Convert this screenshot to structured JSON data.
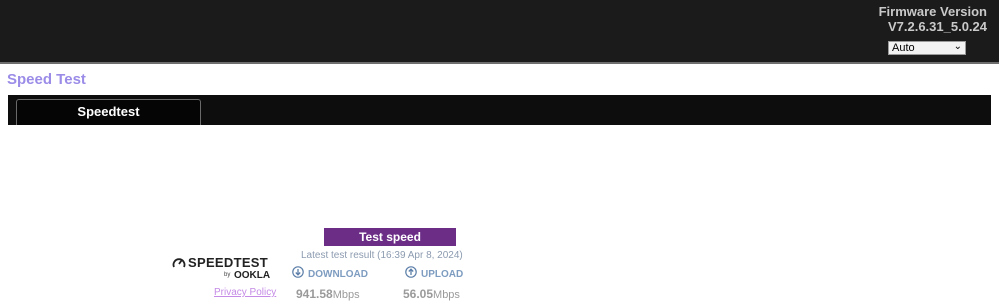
{
  "header": {
    "firmware_label": "Firmware Version",
    "firmware_value": "V7.2.6.31_5.0.24",
    "language_select": "Auto"
  },
  "page": {
    "title": "Speed Test"
  },
  "tabs": [
    {
      "label": "Speedtest"
    }
  ],
  "speedtest": {
    "button_label": "Test speed",
    "latest_result": "Latest test result (16:39 Apr 8, 2024)",
    "logo_text": "SPEEDTEST",
    "logo_by": "by",
    "logo_brand": "OOKLA",
    "privacy_link": "Privacy Policy",
    "download": {
      "label": "DOWNLOAD",
      "value": "941.58",
      "unit": "Mbps"
    },
    "upload": {
      "label": "UPLOAD",
      "value": "56.05",
      "unit": "Mbps"
    }
  },
  "colors": {
    "topbar": "#1b1b1b",
    "title": "#9b8ce8",
    "button": "#6b2d86",
    "metric_label": "#7d9cc0"
  }
}
